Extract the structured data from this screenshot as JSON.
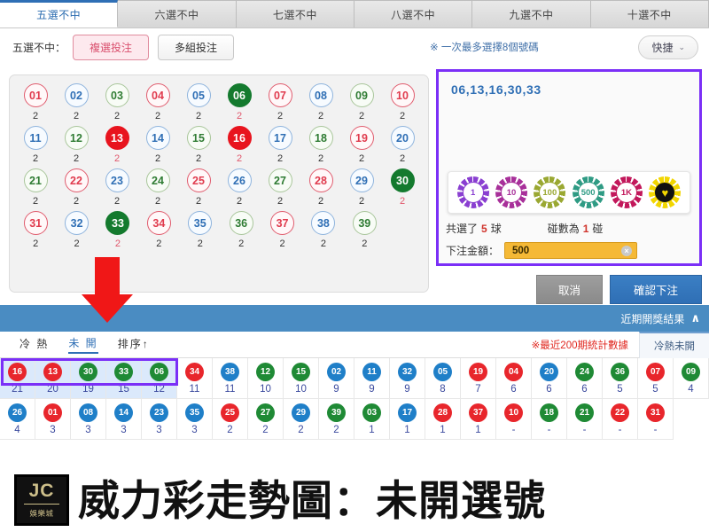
{
  "tabs": [
    {
      "label": "五選不中",
      "active": true
    },
    {
      "label": "六選不中",
      "active": false
    },
    {
      "label": "七選不中",
      "active": false
    },
    {
      "label": "八選不中",
      "active": false
    },
    {
      "label": "九選不中",
      "active": false
    },
    {
      "label": "十選不中",
      "active": false
    }
  ],
  "controls": {
    "mode_label": "五選不中：",
    "multi_select_label": "複選投注",
    "multi_group_label": "多組投注",
    "hint": "※ 一次最多選擇8個號碼",
    "quick_label": "快捷",
    "quick_caret": "⌄"
  },
  "number_grid": {
    "rows": [
      [
        {
          "n": "01",
          "color": "red",
          "count": "2",
          "selected": false
        },
        {
          "n": "02",
          "color": "blue",
          "count": "2",
          "selected": false
        },
        {
          "n": "03",
          "color": "green",
          "count": "2",
          "selected": false
        },
        {
          "n": "04",
          "color": "red",
          "count": "2",
          "selected": false
        },
        {
          "n": "05",
          "color": "blue",
          "count": "2",
          "selected": false
        },
        {
          "n": "06",
          "color": "green",
          "count": "2",
          "selected": true
        },
        {
          "n": "07",
          "color": "red",
          "count": "2",
          "selected": false
        },
        {
          "n": "08",
          "color": "blue",
          "count": "2",
          "selected": false
        },
        {
          "n": "09",
          "color": "green",
          "count": "2",
          "selected": false
        },
        {
          "n": "10",
          "color": "red",
          "count": "2",
          "selected": false
        }
      ],
      [
        {
          "n": "11",
          "color": "blue",
          "count": "2",
          "selected": false
        },
        {
          "n": "12",
          "color": "green",
          "count": "2",
          "selected": false
        },
        {
          "n": "13",
          "color": "red",
          "count": "2",
          "selected": true
        },
        {
          "n": "14",
          "color": "blue",
          "count": "2",
          "selected": false
        },
        {
          "n": "15",
          "color": "green",
          "count": "2",
          "selected": false
        },
        {
          "n": "16",
          "color": "red",
          "count": "2",
          "selected": true
        },
        {
          "n": "17",
          "color": "blue",
          "count": "2",
          "selected": false
        },
        {
          "n": "18",
          "color": "green",
          "count": "2",
          "selected": false
        },
        {
          "n": "19",
          "color": "red",
          "count": "2",
          "selected": false
        },
        {
          "n": "20",
          "color": "blue",
          "count": "2",
          "selected": false
        }
      ],
      [
        {
          "n": "21",
          "color": "green",
          "count": "2",
          "selected": false
        },
        {
          "n": "22",
          "color": "red",
          "count": "2",
          "selected": false
        },
        {
          "n": "23",
          "color": "blue",
          "count": "2",
          "selected": false
        },
        {
          "n": "24",
          "color": "green",
          "count": "2",
          "selected": false
        },
        {
          "n": "25",
          "color": "red",
          "count": "2",
          "selected": false
        },
        {
          "n": "26",
          "color": "blue",
          "count": "2",
          "selected": false
        },
        {
          "n": "27",
          "color": "green",
          "count": "2",
          "selected": false
        },
        {
          "n": "28",
          "color": "red",
          "count": "2",
          "selected": false
        },
        {
          "n": "29",
          "color": "blue",
          "count": "2",
          "selected": false
        },
        {
          "n": "30",
          "color": "green",
          "count": "2",
          "selected": true
        }
      ],
      [
        {
          "n": "31",
          "color": "red",
          "count": "2",
          "selected": false
        },
        {
          "n": "32",
          "color": "blue",
          "count": "2",
          "selected": false
        },
        {
          "n": "33",
          "color": "green",
          "count": "2",
          "selected": true
        },
        {
          "n": "34",
          "color": "red",
          "count": "2",
          "selected": false
        },
        {
          "n": "35",
          "color": "blue",
          "count": "2",
          "selected": false
        },
        {
          "n": "36",
          "color": "green",
          "count": "2",
          "selected": false
        },
        {
          "n": "37",
          "color": "red",
          "count": "2",
          "selected": false
        },
        {
          "n": "38",
          "color": "blue",
          "count": "2",
          "selected": false
        },
        {
          "n": "39",
          "color": "green",
          "count": "2",
          "selected": false
        }
      ]
    ]
  },
  "bet_panel": {
    "selected_numbers": "06,13,16,30,33",
    "chips": [
      {
        "label": "1",
        "color": "#8a3fd1"
      },
      {
        "label": "10",
        "color": "#a8309a"
      },
      {
        "label": "100",
        "color": "#9aa832"
      },
      {
        "label": "500",
        "color": "#2f9b84"
      },
      {
        "label": "1K",
        "color": "#c2185b"
      },
      {
        "label": "♥",
        "color": "#f2d600"
      }
    ],
    "total_prefix": "共選了",
    "total_count": "5",
    "total_suffix": "球",
    "combo_prefix": "碰數為",
    "combo_count": "1",
    "combo_suffix": "碰",
    "amount_label": "下注金額：",
    "amount_value": "500",
    "amount_clear": "×",
    "cancel_label": "取消",
    "confirm_label": "確認下注"
  },
  "results_band": {
    "title": "近期開獎結果",
    "caret": "∧"
  },
  "stats_header": {
    "cold_hot": "冷 熱",
    "unopened": "未 開",
    "sort": "排序↑",
    "note": "※最近200期統計數據",
    "side_tab": "冷熱未開"
  },
  "stats_grid": {
    "rows": [
      [
        {
          "n": "16",
          "color": "red",
          "value": "21",
          "highlight": true
        },
        {
          "n": "13",
          "color": "red",
          "value": "20",
          "highlight": true
        },
        {
          "n": "30",
          "color": "green",
          "value": "19",
          "highlight": true
        },
        {
          "n": "33",
          "color": "green",
          "value": "15",
          "highlight": true
        },
        {
          "n": "06",
          "color": "green",
          "value": "12",
          "highlight": true
        },
        {
          "n": "34",
          "color": "red",
          "value": "11",
          "highlight": false
        },
        {
          "n": "38",
          "color": "blue",
          "value": "11",
          "highlight": false
        },
        {
          "n": "12",
          "color": "green",
          "value": "10",
          "highlight": false
        },
        {
          "n": "15",
          "color": "green",
          "value": "10",
          "highlight": false
        },
        {
          "n": "02",
          "color": "blue",
          "value": "9",
          "highlight": false
        },
        {
          "n": "11",
          "color": "blue",
          "value": "9",
          "highlight": false
        },
        {
          "n": "32",
          "color": "blue",
          "value": "9",
          "highlight": false
        },
        {
          "n": "05",
          "color": "blue",
          "value": "8",
          "highlight": false
        },
        {
          "n": "19",
          "color": "red",
          "value": "7",
          "highlight": false
        },
        {
          "n": "04",
          "color": "red",
          "value": "6",
          "highlight": false
        },
        {
          "n": "20",
          "color": "blue",
          "value": "6",
          "highlight": false
        },
        {
          "n": "24",
          "color": "green",
          "value": "6",
          "highlight": false
        },
        {
          "n": "36",
          "color": "green",
          "value": "5",
          "highlight": false
        },
        {
          "n": "07",
          "color": "red",
          "value": "5",
          "highlight": false
        },
        {
          "n": "09",
          "color": "green",
          "value": "4",
          "highlight": false
        }
      ],
      [
        {
          "n": "26",
          "color": "blue",
          "value": "4",
          "highlight": false
        },
        {
          "n": "01",
          "color": "red",
          "value": "3",
          "highlight": false
        },
        {
          "n": "08",
          "color": "blue",
          "value": "3",
          "highlight": false
        },
        {
          "n": "14",
          "color": "blue",
          "value": "3",
          "highlight": false
        },
        {
          "n": "23",
          "color": "blue",
          "value": "3",
          "highlight": false
        },
        {
          "n": "35",
          "color": "blue",
          "value": "3",
          "highlight": false
        },
        {
          "n": "25",
          "color": "red",
          "value": "2",
          "highlight": false
        },
        {
          "n": "27",
          "color": "green",
          "value": "2",
          "highlight": false
        },
        {
          "n": "29",
          "color": "blue",
          "value": "2",
          "highlight": false
        },
        {
          "n": "39",
          "color": "green",
          "value": "2",
          "highlight": false
        },
        {
          "n": "03",
          "color": "green",
          "value": "1",
          "highlight": false
        },
        {
          "n": "17",
          "color": "blue",
          "value": "1",
          "highlight": false
        },
        {
          "n": "28",
          "color": "red",
          "value": "1",
          "highlight": false
        },
        {
          "n": "37",
          "color": "red",
          "value": "1",
          "highlight": false
        },
        {
          "n": "10",
          "color": "red",
          "value": "-",
          "highlight": false
        },
        {
          "n": "18",
          "color": "green",
          "value": "-",
          "highlight": false
        },
        {
          "n": "21",
          "color": "green",
          "value": "-",
          "highlight": false
        },
        {
          "n": "22",
          "color": "red",
          "value": "-",
          "highlight": false
        },
        {
          "n": "31",
          "color": "red",
          "value": "-",
          "highlight": false
        }
      ]
    ]
  },
  "banner": {
    "logo_jc": "JC",
    "logo_sub": "娛樂城",
    "title": "威力彩走勢圖：未開選號"
  }
}
